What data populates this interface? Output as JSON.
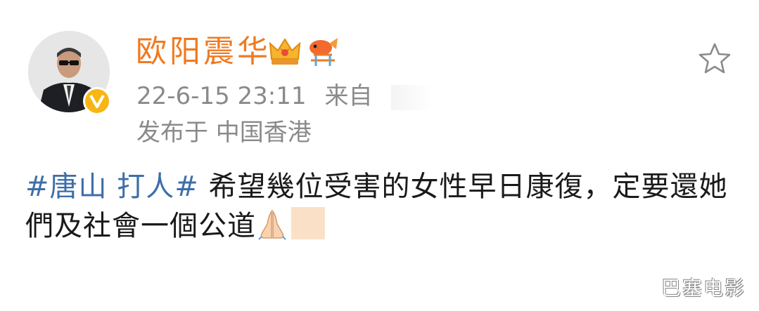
{
  "post": {
    "username": "欧阳震华",
    "date": "22-6-15 23:11",
    "source_prefix": "来自",
    "location": "发布于 中国香港",
    "topic": "#唐山 打人#",
    "body_text": " 希望幾位受害的女性早日康復，定要還她們及社會一個公道"
  },
  "icons": {
    "verified": "verified-v-icon",
    "crown_badge": "crown-badge-icon",
    "koi_badge": "koi-badge-icon",
    "favorite": "star-outline-icon",
    "prayer": "folded-hands-icon"
  },
  "colors": {
    "username": "#f07a22",
    "topic": "#3e6ea8",
    "meta": "#8a8a8a",
    "verified": "#f7b614"
  },
  "watermark": "巴塞电影"
}
